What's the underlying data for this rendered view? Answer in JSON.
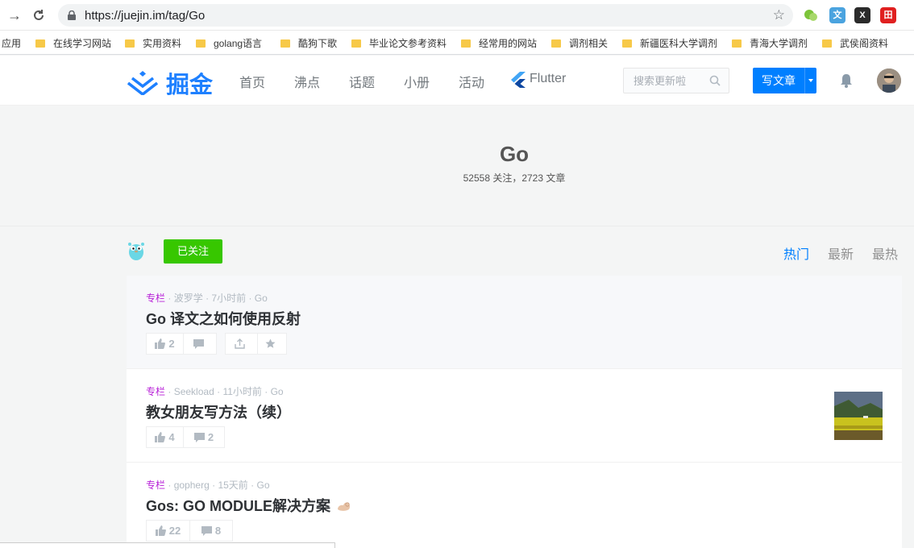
{
  "browser": {
    "url": "https://juejin.im/tag/Go",
    "bookmarks": [
      {
        "label": "应用",
        "folder": false
      },
      {
        "label": "在线学习网站",
        "folder": true
      },
      {
        "label": "实用资料",
        "folder": true
      },
      {
        "label": "golang语言",
        "folder": true
      },
      {
        "label": "酷狗下歌",
        "folder": true
      },
      {
        "label": "毕业论文参考资料",
        "folder": true
      },
      {
        "label": "经常用的网站",
        "folder": true
      },
      {
        "label": "调剂相关",
        "folder": true
      },
      {
        "label": "新疆医科大学调剂",
        "folder": true
      },
      {
        "label": "青海大学调剂",
        "folder": true
      },
      {
        "label": "武侯阁资料",
        "folder": true
      }
    ]
  },
  "header": {
    "logo_text": "掘金",
    "nav": [
      "首页",
      "沸点",
      "话题",
      "小册",
      "活动",
      "Flutter"
    ],
    "search_placeholder": "搜索更新啦",
    "write_label": "写文章"
  },
  "tag": {
    "name": "Go",
    "stats": "52558 关注，2723 文章",
    "follow_label": "已关注",
    "sort_tabs": [
      "热门",
      "最新",
      "最热"
    ],
    "active_sort": "热门"
  },
  "entries": [
    {
      "category": "专栏",
      "author": "波罗学",
      "time": "7小时前",
      "tag": "Go",
      "title": "Go 译文之如何使用反射",
      "likes": "2",
      "comments": "",
      "has_share": true,
      "has_thumb": false
    },
    {
      "category": "专栏",
      "author": "Seekload",
      "time": "11小时前",
      "tag": "Go",
      "title": "教女朋友写方法（续）",
      "likes": "4",
      "comments": "2",
      "has_share": false,
      "has_thumb": true
    },
    {
      "category": "专栏",
      "author": "gopherg",
      "time": "15天前",
      "tag": "Go",
      "title": "Gos: GO MODULE解决方案",
      "likes": "22",
      "comments": "8",
      "has_share": false,
      "has_thumb": false
    }
  ],
  "colors": {
    "brand": "#1e80ff",
    "follow": "#37c700",
    "category": "#b71ed7"
  }
}
